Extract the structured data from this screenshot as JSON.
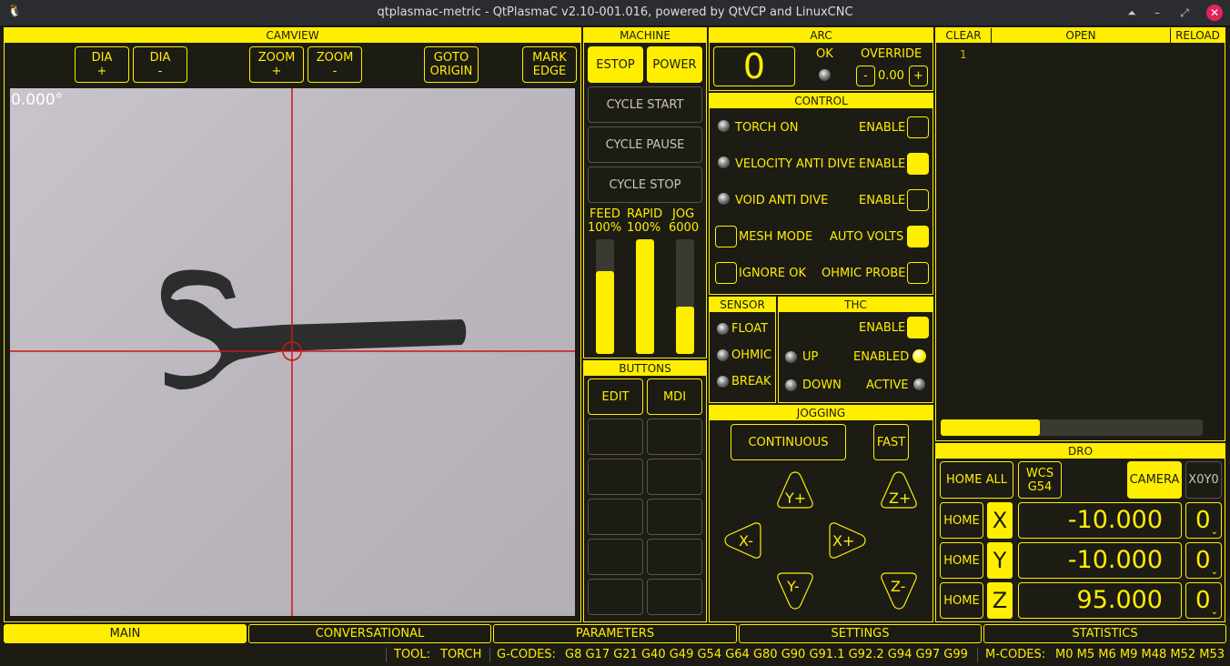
{
  "window": {
    "title": "qtplasmac-metric - QtPlasmaC v2.10-001.016, powered by QtVCP and LinuxCNC"
  },
  "camview": {
    "header": "CAMVIEW",
    "buttons": [
      {
        "line1": "DIA",
        "line2": "+"
      },
      {
        "line1": "DIA",
        "line2": "-"
      },
      {
        "line1": "ZOOM",
        "line2": "+"
      },
      {
        "line1": "ZOOM",
        "line2": "-"
      },
      {
        "line1": "GOTO",
        "line2": "ORIGIN"
      },
      {
        "line1": "MARK",
        "line2": "EDGE"
      }
    ],
    "angle": "0.000°"
  },
  "machine": {
    "header": "MACHINE",
    "estop": "ESTOP",
    "power": "POWER",
    "cycle_start": "CYCLE START",
    "cycle_pause": "CYCLE PAUSE",
    "cycle_stop": "CYCLE STOP",
    "feed": {
      "label": "FEED",
      "value": "100%",
      "level": 0.72
    },
    "rapid": {
      "label": "RAPID",
      "value": "100%",
      "level": 1.0
    },
    "jog": {
      "label": "JOG",
      "value": "6000",
      "level": 0.41
    }
  },
  "buttons_panel": {
    "header": "BUTTONS",
    "edit": "EDIT",
    "mdi": "MDI"
  },
  "arc": {
    "header": "ARC",
    "value": "0",
    "ok_label": "OK",
    "override_label": "OVERRIDE",
    "minus": "-",
    "plus": "+",
    "override_value": "0.00"
  },
  "control": {
    "header": "CONTROL",
    "torch_on": "TORCH ON",
    "velocity_anti_dive": "VELOCITY ANTI DIVE",
    "void_anti_dive": "VOID ANTI DIVE",
    "enable": "ENABLE",
    "mesh_mode": "MESH MODE",
    "auto_volts": "AUTO VOLTS",
    "ignore_ok": "IGNORE OK",
    "ohmic_probe": "OHMIC PROBE"
  },
  "sensor": {
    "header": "SENSOR",
    "float": "FLOAT",
    "ohmic": "OHMIC",
    "break": "BREAK"
  },
  "thc": {
    "header": "THC",
    "enable": "ENABLE",
    "up": "UP",
    "enabled": "ENABLED",
    "down": "DOWN",
    "active": "ACTIVE"
  },
  "jogging": {
    "header": "JOGGING",
    "mode": "CONTINUOUS",
    "fast": "FAST",
    "y_plus": "Y+",
    "z_plus": "Z+",
    "x_minus": "X-",
    "x_plus": "X+",
    "y_minus": "Y-",
    "z_minus": "Z-"
  },
  "gcode": {
    "clear": "CLEAR",
    "open": "OPEN",
    "reload": "RELOAD",
    "line_number": "1",
    "progress": 0.38
  },
  "dro": {
    "header": "DRO",
    "home_all": "HOME ALL",
    "wcs_line1": "WCS",
    "wcs_line2": "G54",
    "camera": "CAMERA",
    "x0y0": "X0Y0",
    "home": "HOME",
    "axes": [
      {
        "name": "X",
        "value": "-10.000",
        "offset": "0"
      },
      {
        "name": "Y",
        "value": "-10.000",
        "offset": "0"
      },
      {
        "name": "Z",
        "value": "95.000",
        "offset": "0"
      }
    ]
  },
  "tabs": [
    "MAIN",
    "CONVERSATIONAL",
    "PARAMETERS",
    "SETTINGS",
    "STATISTICS"
  ],
  "status": {
    "tool_label": "TOOL:",
    "tool_value": "TORCH",
    "gcodes_label": "G-CODES:",
    "gcodes_value": "G8 G17 G21 G40 G49 G54 G64 G80 G90 G91.1 G92.2 G94 G97 G99",
    "mcodes_label": "M-CODES:",
    "mcodes_value": "M0 M5 M6 M9 M48 M52 M53"
  }
}
